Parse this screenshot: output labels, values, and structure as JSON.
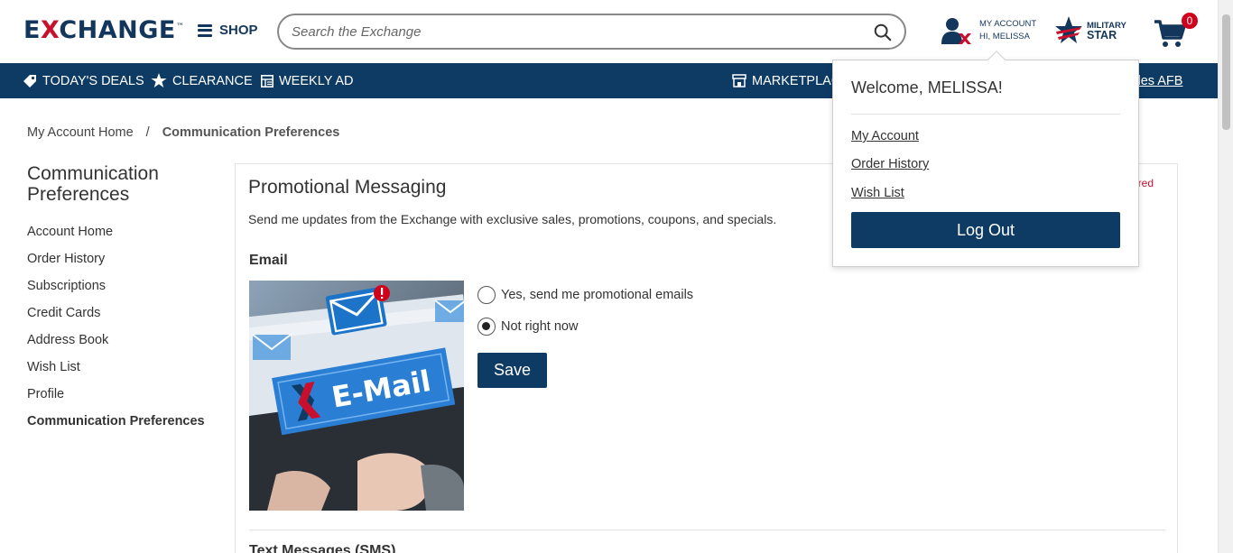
{
  "header": {
    "logo_left": "E",
    "logo_x": "X",
    "logo_right": "CHANGE",
    "logo_tm": "™",
    "shop_label": "SHOP",
    "search_placeholder": "Search the Exchange",
    "account_line1": "MY ACCOUNT",
    "account_line2": "HI, MELISSA",
    "military_line1": "MILITARY",
    "military_line2": "STAR",
    "cart_count": "0"
  },
  "nav": {
    "deals": "TODAY'S DEALS",
    "clearance": "CLEARANCE",
    "weekly_ad": "WEEKLY AD",
    "marketplace": "MARKETPLACE",
    "base": "Los Angeles AFB"
  },
  "breadcrumb": {
    "home": "My Account Home",
    "separator": "/",
    "current": "Communication Preferences"
  },
  "sidebar": {
    "title": "Communication Preferences",
    "items": [
      {
        "label": "Account Home"
      },
      {
        "label": "Order History"
      },
      {
        "label": "Subscriptions"
      },
      {
        "label": "Credit Cards"
      },
      {
        "label": "Address Book"
      },
      {
        "label": "Wish List"
      },
      {
        "label": "Profile"
      },
      {
        "label": "Communication Preferences"
      }
    ]
  },
  "main": {
    "title": "Promotional Messaging",
    "required_note": "* Required",
    "description": "Send me updates from the Exchange with exclusive sales, promotions, coupons, and specials.",
    "email_heading": "Email",
    "image_text": "E-Mail",
    "option_yes": "Yes, send me promotional emails",
    "option_no": "Not right now",
    "selected": "Not right now",
    "save_label": "Save",
    "sms_heading": "Text Messages (SMS)"
  },
  "dropdown": {
    "welcome": "Welcome, MELISSA!",
    "my_account": "My Account",
    "order_history": "Order History",
    "wish_list": "Wish List",
    "logout": "Log Out"
  },
  "colors": {
    "navy": "#0e3b63",
    "brand_red": "#c8102e",
    "badge_red": "#d0021b"
  }
}
